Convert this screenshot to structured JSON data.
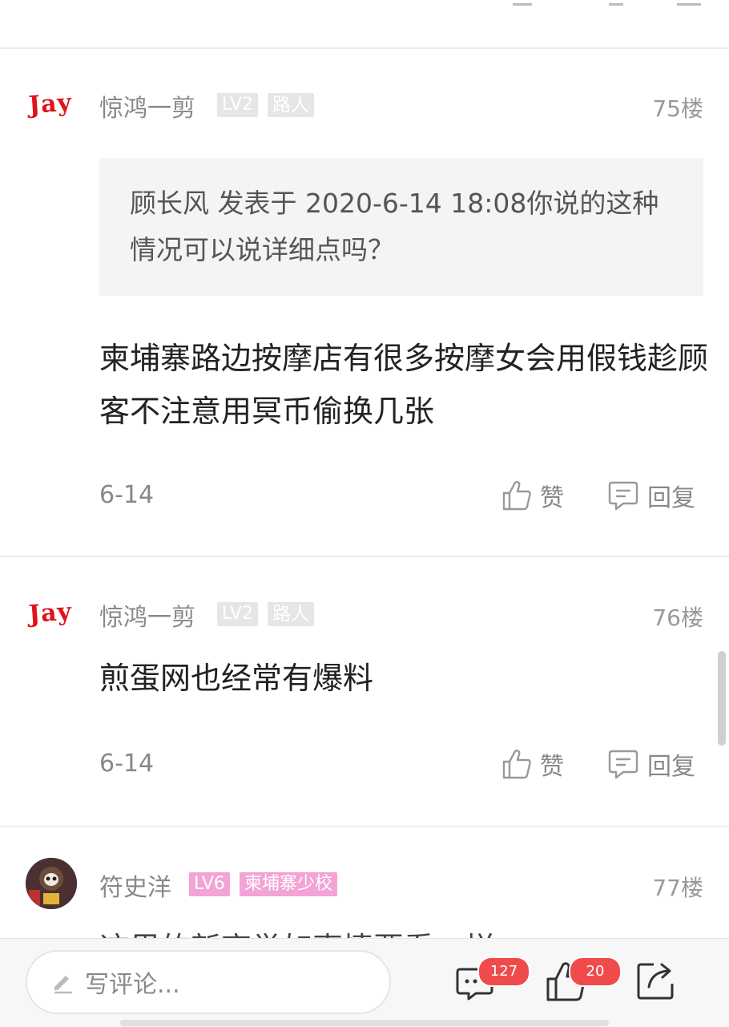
{
  "posts": [
    {
      "username": "惊鸿一剪",
      "avatar_text": "Jay",
      "level": "LV2",
      "title": "路人",
      "floor": "75楼",
      "quote": "顾长风 发表于 2020-6-14 18:08你说的这种情况可以说详细点吗？",
      "content": "柬埔寨路边按摩店有很多按摩女会用假钱趁顾客不注意用冥币偷换几张",
      "date": "6-14",
      "like_label": "赞",
      "reply_label": "回复"
    },
    {
      "username": "惊鸿一剪",
      "avatar_text": "Jay",
      "level": "LV2",
      "title": "路人",
      "floor": "76楼",
      "content": "煎蛋网也经常有爆料",
      "date": "6-14",
      "like_label": "赞",
      "reply_label": "回复"
    },
    {
      "username": "符史洋",
      "level": "LV6",
      "title": "柬埔寨少校",
      "floor": "77楼",
      "content_partial": "这里的新高举如事情要看一样"
    }
  ],
  "bottom_bar": {
    "placeholder": "写评论...",
    "comments_count": "127",
    "likes_count": "20"
  },
  "icons": {
    "like": "thumbs-up-icon",
    "reply": "speech-bubble-icon",
    "comment": "comment-icon",
    "share": "share-icon",
    "edit": "pencil-icon"
  },
  "colors": {
    "accent": "#e0121b",
    "badge_gray": "#e6e6e6",
    "badge_pink": "#f3a3d6",
    "count_badge": "#f04b4b"
  }
}
